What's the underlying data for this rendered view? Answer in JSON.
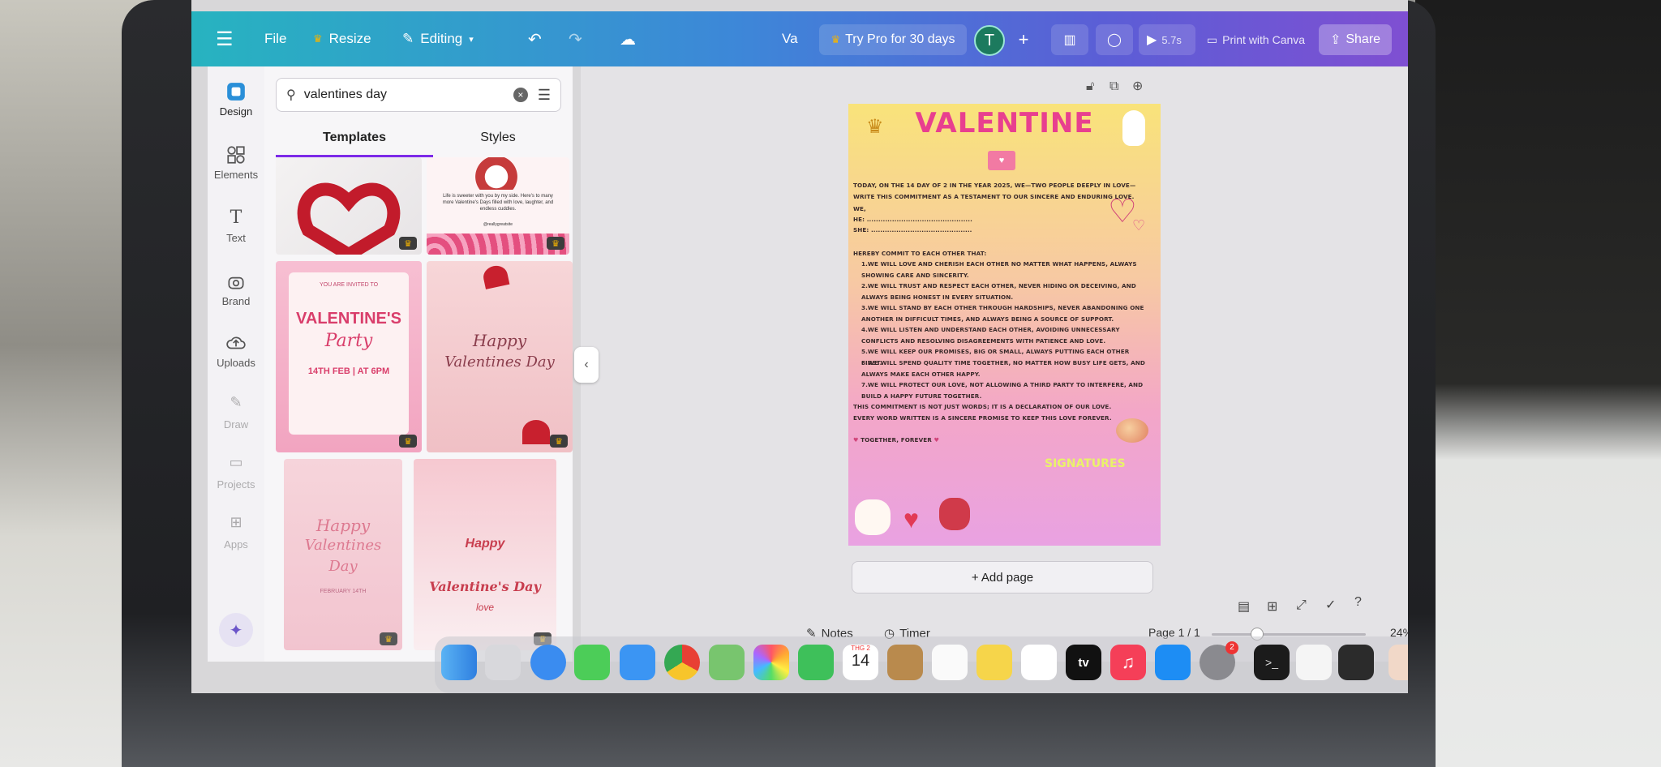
{
  "topbar": {
    "menu_icon": "hamburger-icon",
    "file": "File",
    "resize": "Resize",
    "editing": "Editing",
    "doc_title": "Va",
    "try_pro": "Try Pro for 30 days",
    "avatar_initial": "T",
    "print_label": "Print with Canva",
    "play_label": "5.7s",
    "share": "Share"
  },
  "rail": {
    "items": [
      {
        "label": "Design",
        "icon": "design-icon"
      },
      {
        "label": "Elements",
        "icon": "elements-icon"
      },
      {
        "label": "Text",
        "icon": "text-icon"
      },
      {
        "label": "Brand",
        "icon": "brand-icon"
      },
      {
        "label": "Uploads",
        "icon": "uploads-icon"
      },
      {
        "label": "Draw",
        "icon": "draw-icon"
      },
      {
        "label": "Projects",
        "icon": "projects-icon"
      },
      {
        "label": "Apps",
        "icon": "apps-icon"
      }
    ]
  },
  "panel": {
    "search_value": "valentines day",
    "tabs": [
      "Templates",
      "Styles"
    ],
    "active_tab": "Templates",
    "templates": [
      {
        "text": ""
      },
      {
        "text": "Life is sweeter with you by my side. Here's to many more Valentine's Days filled with love, laughter, and endless cuddles.",
        "sub": "@reallygreatsite"
      },
      {
        "text": "YOU ARE INVITED TO",
        "title": "VALENTINE'S",
        "title2": "Party",
        "sub": "14TH FEB | AT 6PM"
      },
      {
        "title": "Happy",
        "title2": "Valentines Day"
      },
      {
        "title": "Happy",
        "title2": "Valentines",
        "title3": "Day",
        "sub": "FEBRUARY 14TH"
      },
      {
        "title": "Happy",
        "title2": "Valentine's Day",
        "title3": "love"
      }
    ]
  },
  "page_toolbar": [
    "lock-icon",
    "duplicate-icon",
    "add-page-icon"
  ],
  "document": {
    "title": "VALENTINE",
    "intro": "TODAY, ON THE 14 DAY OF 2 IN THE YEAR 2025, WE—TWO PEOPLE DEEPLY IN LOVE—WRITE THIS COMMITMENT AS A TESTAMENT TO OUR SINCERE AND ENDURING LOVE.",
    "we": "WE,",
    "he": "HE: ..............................................",
    "she": "SHE: ............................................",
    "commit": "HEREBY COMMIT TO EACH OTHER THAT:",
    "items": [
      "1.WE WILL LOVE AND CHERISH EACH OTHER NO MATTER WHAT HAPPENS, ALWAYS SHOWING CARE AND SINCERITY.",
      "2.WE WILL TRUST AND RESPECT EACH OTHER, NEVER HIDING OR DECEIVING, AND ALWAYS BEING HONEST IN EVERY SITUATION.",
      "3.WE WILL STAND BY EACH OTHER THROUGH HARDSHIPS, NEVER ABANDONING ONE ANOTHER IN DIFFICULT TIMES, AND ALWAYS BEING A SOURCE OF SUPPORT.",
      "4.WE WILL LISTEN AND UNDERSTAND EACH OTHER, AVOIDING UNNECESSARY CONFLICTS AND RESOLVING DISAGREEMENTS WITH PATIENCE AND LOVE.",
      "5.WE WILL KEEP OUR PROMISES, BIG OR SMALL, ALWAYS PUTTING EACH OTHER FIRST.",
      "6.WE WILL SPEND QUALITY TIME TOGETHER, NO MATTER HOW BUSY LIFE GETS, AND ALWAYS MAKE EACH OTHER HAPPY.",
      "7.WE WILL PROTECT OUR LOVE, NOT ALLOWING A THIRD PARTY TO INTERFERE, AND BUILD A HAPPY FUTURE TOGETHER."
    ],
    "closing": "THIS COMMITMENT IS NOT JUST WORDS; IT IS A DECLARATION OF OUR LOVE. EVERY WORD WRITTEN IS A SINCERE PROMISE TO KEEP THIS LOVE FOREVER.",
    "together": "TOGETHER, FOREVER",
    "signatures": "SIGNATURES"
  },
  "canvas": {
    "add_page": "+ Add page",
    "notes": "Notes",
    "timer": "Timer",
    "page_indicator": "Page 1 / 1",
    "zoom": "24%",
    "zoom_level": 0.24
  },
  "dock": {
    "calendar_month": "THG 2",
    "calendar_day": "14",
    "tv_label": "tv",
    "settings_badge": "2"
  },
  "colors": {
    "topbar_start": "#27b3c0",
    "topbar_end": "#7f4fd2",
    "accent": "#7d2ae8",
    "title_pink": "#e83f8f"
  }
}
